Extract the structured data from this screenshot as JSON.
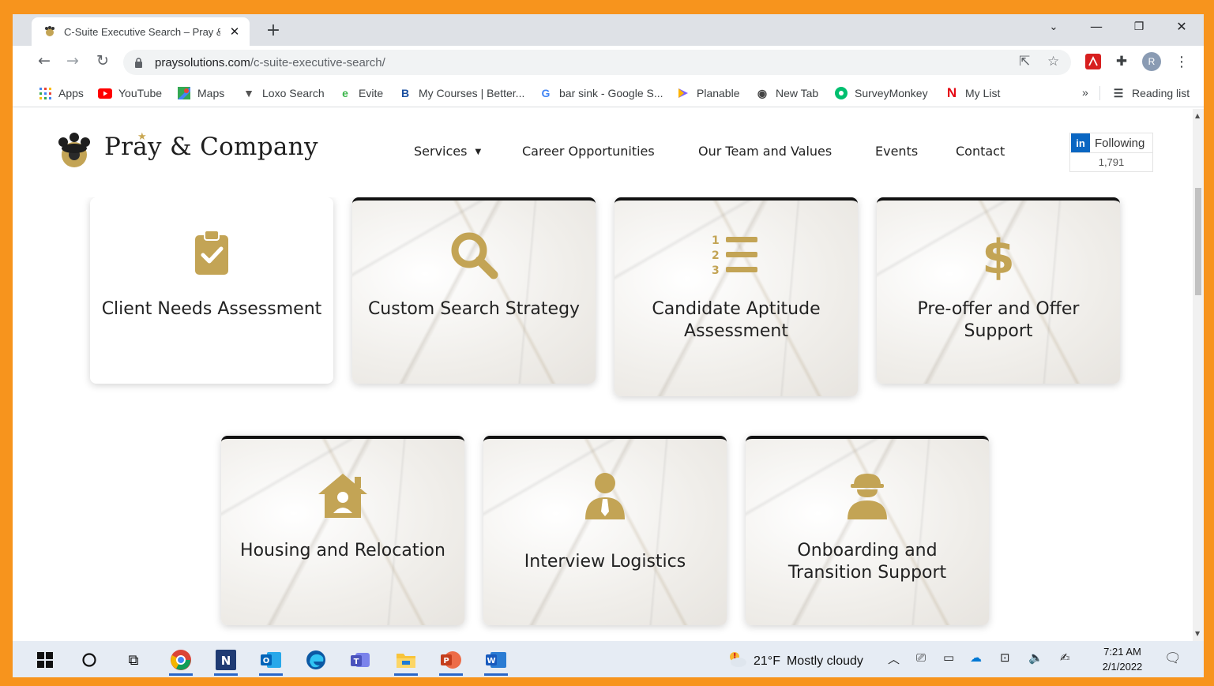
{
  "browser": {
    "tab_title": "C-Suite Executive Search – Pray & C",
    "url_domain": "praysolutions.com",
    "url_path": "/c-suite-executive-search/",
    "profile_initial": "R",
    "bookmarks": [
      {
        "label": "Apps",
        "icon": "apps-grid-icon",
        "color": "#4285f4"
      },
      {
        "label": "YouTube",
        "icon": "youtube-icon",
        "color": "#ff0000"
      },
      {
        "label": "Maps",
        "icon": "maps-icon",
        "color": "#34a853"
      },
      {
        "label": "Loxo Search",
        "icon": "loxo-icon",
        "color": "#555555"
      },
      {
        "label": "Evite",
        "icon": "evite-icon",
        "color": "#3ab54a"
      },
      {
        "label": "My Courses | Better...",
        "icon": "better-icon",
        "color": "#1a4fa0"
      },
      {
        "label": "bar sink - Google S...",
        "icon": "google-icon",
        "color": "#4285f4"
      },
      {
        "label": "Planable",
        "icon": "planable-icon",
        "color": "#7b61ff"
      },
      {
        "label": "New Tab",
        "icon": "globe-icon",
        "color": "#444444"
      },
      {
        "label": "SurveyMonkey",
        "icon": "surveymonkey-icon",
        "color": "#00bf6f"
      },
      {
        "label": "My List",
        "icon": "netflix-icon",
        "color": "#e50914"
      }
    ],
    "overflow_label": "»",
    "reading_list_label": "Reading list"
  },
  "site": {
    "logo_text": "Pray & Company",
    "nav": {
      "services": "Services",
      "careers": "Career Opportunities",
      "team": "Our Team and Values",
      "events": "Events",
      "contact": "Contact"
    },
    "linkedin": {
      "badge": "in",
      "label": "Following",
      "count": "1,791"
    },
    "accent_color": "#c3a455"
  },
  "services": [
    {
      "title": "Client Needs Assessment",
      "icon": "clipboard-check-icon"
    },
    {
      "title": "Custom Search Strategy",
      "icon": "magnifier-icon"
    },
    {
      "title": "Candidate Aptitude Assessment",
      "icon": "numbered-list-icon"
    },
    {
      "title": "Pre-offer and Offer Support",
      "icon": "dollar-sign-icon"
    },
    {
      "title": "Housing and Relocation",
      "icon": "house-user-icon"
    },
    {
      "title": "Interview Logistics",
      "icon": "user-tie-icon"
    },
    {
      "title": "Onboarding and Transition Support",
      "icon": "hard-hat-worker-icon"
    }
  ],
  "taskbar": {
    "weather_temp": "21°F",
    "weather_desc": "Mostly cloudy",
    "time": "7:21 AM",
    "date": "2/1/2022"
  }
}
